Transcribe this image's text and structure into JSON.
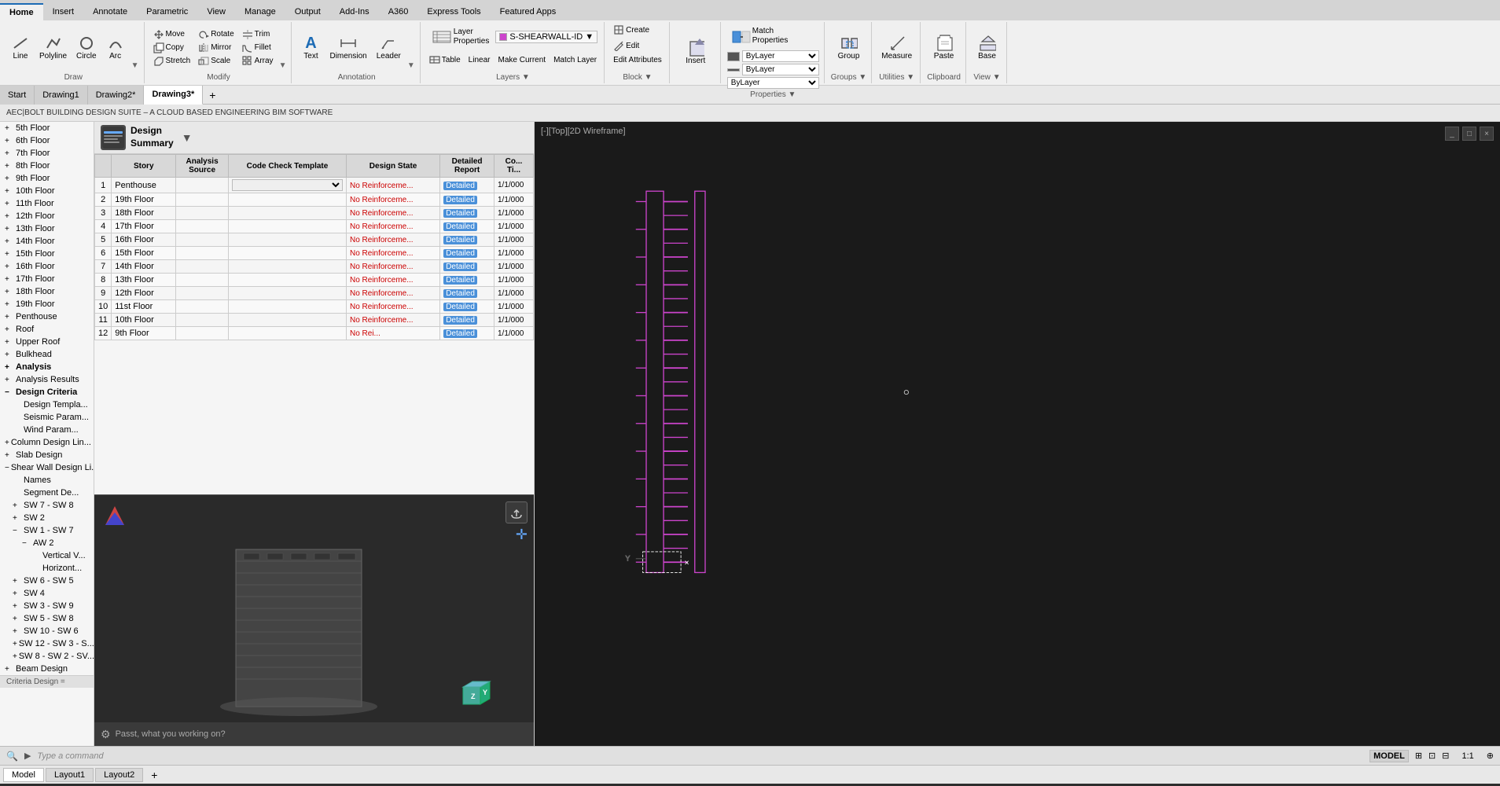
{
  "app": {
    "title": "AEC|BOLT BUILDING DESIGN SUITE – A CLOUD BASED ENGINEERING BIM SOFTWARE"
  },
  "ribbon": {
    "tabs": [
      "Home",
      "Insert",
      "Annotate",
      "Parametric",
      "View",
      "Manage",
      "Output",
      "Add-Ins",
      "A360",
      "Express Tools",
      "Featured Apps"
    ],
    "active_tab": "Home",
    "groups": {
      "draw": {
        "label": "Draw",
        "buttons": [
          {
            "label": "Line",
            "name": "line-button"
          },
          {
            "label": "Polyline",
            "name": "polyline-button"
          },
          {
            "label": "Circle",
            "name": "circle-button"
          },
          {
            "label": "Arc",
            "name": "arc-button"
          }
        ]
      },
      "modify": {
        "label": "Modify",
        "buttons": [
          {
            "label": "Move",
            "name": "move-button"
          },
          {
            "label": "Rotate",
            "name": "rotate-button"
          },
          {
            "label": "Trim",
            "name": "trim-button"
          },
          {
            "label": "Copy",
            "name": "copy-button"
          },
          {
            "label": "Mirror",
            "name": "mirror-button"
          },
          {
            "label": "Fillet",
            "name": "fillet-button"
          },
          {
            "label": "Stretch",
            "name": "stretch-button"
          },
          {
            "label": "Scale",
            "name": "scale-button"
          },
          {
            "label": "Array",
            "name": "array-button"
          }
        ]
      },
      "annotation": {
        "label": "Annotation",
        "buttons": [
          {
            "label": "Text",
            "name": "text-button"
          },
          {
            "label": "Dimension",
            "name": "dimension-button"
          },
          {
            "label": "Leader",
            "name": "leader-button"
          }
        ]
      },
      "layers": {
        "label": "Layers",
        "buttons": [
          {
            "label": "Layer\nProperties",
            "name": "layer-properties-button"
          },
          {
            "label": "Table",
            "name": "table-button"
          },
          {
            "label": "Linear",
            "name": "linear-button"
          },
          {
            "label": "Make Current",
            "name": "make-current-button"
          },
          {
            "label": "Match Layer",
            "name": "match-layer-button"
          }
        ],
        "layer_name": "S-SHEARWALL-ID"
      },
      "block": {
        "label": "Block",
        "buttons": [
          {
            "label": "Create",
            "name": "create-block-button"
          },
          {
            "label": "Edit",
            "name": "edit-block-button"
          },
          {
            "label": "Edit Attributes",
            "name": "edit-attributes-button"
          }
        ]
      },
      "properties": {
        "label": "Properties",
        "buttons": [
          {
            "label": "Match\nProperties",
            "name": "match-properties-button"
          }
        ],
        "bylayer1": "ByLayer",
        "bylayer2": "ByLayer",
        "bylayer3": "ByLayer"
      },
      "groups_group": {
        "label": "Groups",
        "buttons": [
          {
            "label": "Group",
            "name": "group-button"
          }
        ]
      },
      "utilities": {
        "label": "Utilities",
        "buttons": [
          {
            "label": "Measure",
            "name": "measure-button"
          }
        ]
      },
      "clipboard": {
        "label": "Clipboard",
        "buttons": [
          {
            "label": "Paste",
            "name": "paste-button"
          }
        ]
      },
      "view": {
        "label": "View",
        "buttons": [
          {
            "label": "Base",
            "name": "base-button"
          }
        ]
      }
    }
  },
  "doc_tabs": [
    {
      "label": "Start",
      "active": false
    },
    {
      "label": "Drawing1",
      "active": false
    },
    {
      "label": "Drawing2*",
      "active": false
    },
    {
      "label": "Drawing3*",
      "active": true
    }
  ],
  "viewport": {
    "label": "[-][Top][2D Wireframe]"
  },
  "left_tree": {
    "items": [
      {
        "label": "5th Floor",
        "indent": 0,
        "expanded": false
      },
      {
        "label": "6th Floor",
        "indent": 0,
        "expanded": false
      },
      {
        "label": "7th Floor",
        "indent": 0,
        "expanded": false
      },
      {
        "label": "8th Floor",
        "indent": 0,
        "expanded": false
      },
      {
        "label": "9th Floor",
        "indent": 0,
        "expanded": false
      },
      {
        "label": "10th Floor",
        "indent": 0,
        "expanded": false
      },
      {
        "label": "11th Floor",
        "indent": 0,
        "expanded": false
      },
      {
        "label": "12th Floor",
        "indent": 0,
        "expanded": false
      },
      {
        "label": "13th Floor",
        "indent": 0,
        "expanded": false
      },
      {
        "label": "14th Floor",
        "indent": 0,
        "expanded": false
      },
      {
        "label": "15th Floor",
        "indent": 0,
        "expanded": false
      },
      {
        "label": "16th Floor",
        "indent": 0,
        "expanded": false
      },
      {
        "label": "17th Floor",
        "indent": 0,
        "expanded": false
      },
      {
        "label": "18th Floor",
        "indent": 0,
        "expanded": false
      },
      {
        "label": "19th Floor",
        "indent": 0,
        "expanded": false
      },
      {
        "label": "Penthouse",
        "indent": 0,
        "expanded": false
      },
      {
        "label": "Roof",
        "indent": 0,
        "expanded": false
      },
      {
        "label": "Upper Roof",
        "indent": 0,
        "expanded": false
      },
      {
        "label": "Bulkhead",
        "indent": 0,
        "expanded": false
      },
      {
        "label": "Analysis",
        "indent": 0,
        "expanded": false,
        "bold": true
      },
      {
        "label": "Analysis Results",
        "indent": 0,
        "expanded": false
      },
      {
        "label": "Design Criteria",
        "indent": 0,
        "expanded": true,
        "bold": true
      },
      {
        "label": "Design Template",
        "indent": 1
      },
      {
        "label": "Seismic Paramete...",
        "indent": 1
      },
      {
        "label": "Wind Paramete...",
        "indent": 1
      },
      {
        "label": "Column Design Line...",
        "indent": 0
      },
      {
        "label": "Slab Design",
        "indent": 0
      },
      {
        "label": "Shear Wall Design Li...",
        "indent": 0,
        "expanded": true
      },
      {
        "label": "Names",
        "indent": 1
      },
      {
        "label": "Segment De...",
        "indent": 1
      },
      {
        "label": "SW 7 - SW 8",
        "indent": 1,
        "expanded": false
      },
      {
        "label": "SW 2",
        "indent": 1,
        "expanded": false
      },
      {
        "label": "SW 1 - SW 7",
        "indent": 1,
        "expanded": true
      },
      {
        "label": "AW 2",
        "indent": 2,
        "expanded": true
      },
      {
        "label": "Vertical V...",
        "indent": 3
      },
      {
        "label": "Horizont...",
        "indent": 3
      },
      {
        "label": "SW 6 - SW 5",
        "indent": 1,
        "expanded": false
      },
      {
        "label": "SW 4",
        "indent": 1,
        "expanded": false
      },
      {
        "label": "SW 3 - SW 9",
        "indent": 1,
        "expanded": false
      },
      {
        "label": "SW 5 - SW 8",
        "indent": 1,
        "expanded": false
      },
      {
        "label": "SW 10 - SW 6",
        "indent": 1,
        "expanded": false
      },
      {
        "label": "SW 12 - SW 3 - S...",
        "indent": 1,
        "expanded": false
      },
      {
        "label": "SW 8 - SW 2 - SV...",
        "indent": 1,
        "expanded": false
      },
      {
        "label": "Beam Design",
        "indent": 0
      }
    ]
  },
  "design_summary": {
    "title": "Design\nSummary",
    "columns": [
      "",
      "Story",
      "Analysis\nSource",
      "Code Check Template",
      "Design State",
      "Detailed\nReport",
      "Co...\nTi..."
    ],
    "rows": [
      {
        "num": 1,
        "story": "Penthouse",
        "analysis": "",
        "template": "",
        "state": "No Reinforceme...",
        "report": "Detailed",
        "col": "1/1/000"
      },
      {
        "num": 2,
        "story": "19th Floor",
        "analysis": "",
        "template": "",
        "state": "No Reinforceme...",
        "report": "Detailed",
        "col": "1/1/000"
      },
      {
        "num": 3,
        "story": "18th Floor",
        "analysis": "",
        "template": "",
        "state": "No Reinforceme...",
        "report": "Detailed",
        "col": "1/1/000"
      },
      {
        "num": 4,
        "story": "17th Floor",
        "analysis": "",
        "template": "",
        "state": "No Reinforceme...",
        "report": "Detailed",
        "col": "1/1/000"
      },
      {
        "num": 5,
        "story": "16th Floor",
        "analysis": "",
        "template": "",
        "state": "No Reinforceme...",
        "report": "Detailed",
        "col": "1/1/000"
      },
      {
        "num": 6,
        "story": "15th Floor",
        "analysis": "",
        "template": "",
        "state": "No Reinforceme...",
        "report": "Detailed",
        "col": "1/1/000"
      },
      {
        "num": 7,
        "story": "14th Floor",
        "analysis": "",
        "template": "",
        "state": "No Reinforceme...",
        "report": "Detailed",
        "col": "1/1/000"
      },
      {
        "num": 8,
        "story": "13th Floor",
        "analysis": "",
        "template": "",
        "state": "No Reinforceme...",
        "report": "Detailed",
        "col": "1/1/000"
      },
      {
        "num": 9,
        "story": "12th Floor",
        "analysis": "",
        "template": "",
        "state": "No Reinforceme...",
        "report": "Detailed",
        "col": "1/1/000"
      },
      {
        "num": 10,
        "story": "11st Floor",
        "analysis": "",
        "template": "",
        "state": "No Reinforceme...",
        "report": "Detailed",
        "col": "1/1/000"
      },
      {
        "num": 11,
        "story": "10th Floor",
        "analysis": "",
        "template": "",
        "state": "No Reinforceme...",
        "report": "Detailed",
        "col": "1/1/000"
      },
      {
        "num": 12,
        "story": "9th Floor",
        "analysis": "",
        "template": "",
        "state": "No Rei...",
        "report": "Detailed",
        "col": "1/1/000"
      }
    ]
  },
  "chat_bar": {
    "placeholder": "Passt, what you working on?"
  },
  "status_bar": {
    "model_mode": "MODEL",
    "command_placeholder": "Type a command",
    "scale": "1:1"
  },
  "bottom_tabs": [
    {
      "label": "Model",
      "active": true
    },
    {
      "label": "Layout1",
      "active": false
    },
    {
      "label": "Layout2",
      "active": false
    }
  ],
  "criteria_design": {
    "label": "Criteria Design ="
  },
  "colors": {
    "accent_blue": "#1c6bb5",
    "wall_color": "#cc44cc",
    "bg_dark": "#1a1a1a",
    "bg_medium": "#2d2d2d",
    "layer_color": "#cc44cc"
  }
}
